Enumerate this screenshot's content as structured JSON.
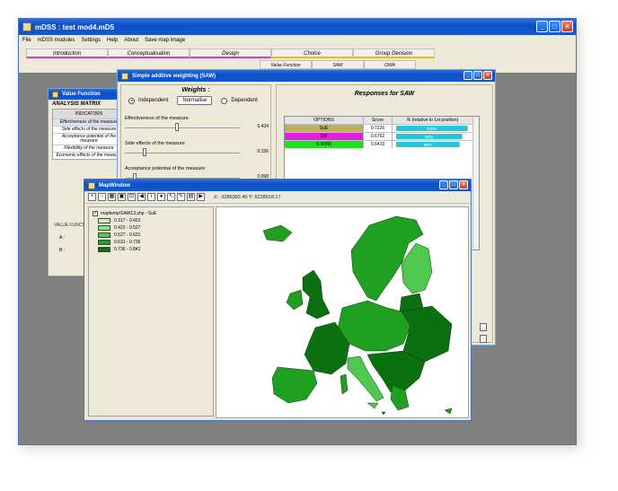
{
  "app": {
    "title": "mDSS : test mod4.mD5",
    "menu": [
      "File",
      "mDSS modules",
      "Settings",
      "Help",
      "About",
      "Save map image"
    ]
  },
  "phase_tabs": [
    {
      "label": "Introduction"
    },
    {
      "label": "Conceptualisation"
    },
    {
      "label": "Design"
    },
    {
      "label": "Choice"
    },
    {
      "label": "Group Decision"
    }
  ],
  "choice_subtabs": [
    {
      "label": "Value Function"
    },
    {
      "label": "SAW"
    },
    {
      "label": "OWA"
    }
  ],
  "value_function_window": {
    "title": "Value Function",
    "analysis_matrix": "ANALYSIS MATRIX",
    "indicators_header": "INDICATORS",
    "indicators": [
      "Effectiveness of the measure",
      "Side effects of the measure",
      "Acceptance potential of the measure",
      "Flexibility of the measure",
      "Economic effects of the measure"
    ],
    "value_function_label": "VALUE FUNCTION",
    "a_label": "A :",
    "b_label": "B :"
  },
  "saw_window": {
    "title": "Simple additive weighting (SAW)",
    "weights_title": "Weights :",
    "mode_independent": "Independent",
    "normalise_button": "Normalise",
    "mode_dependent": "Dependent",
    "criteria": [
      {
        "label": "Effectiveness of the measure",
        "value": 0.434,
        "value_text": "0.434"
      },
      {
        "label": "Side effects of the measure",
        "value": 0.156,
        "value_text": "0.156"
      },
      {
        "label": "Acceptance potential of the measure",
        "value": 0.068,
        "value_text": "0.068"
      }
    ],
    "responses_title": "Responses for SAW",
    "columns": [
      "OPTIONS",
      "Score",
      "% (relative to 1st position)"
    ],
    "rows": [
      {
        "option": "SuE",
        "score": "0.7226",
        "percent": "100%",
        "fraction": 1.0,
        "option_color": "#b8b060",
        "bar_color": "#20c8d8"
      },
      {
        "option": "SW",
        "score": "0.6762",
        "percent": "93%",
        "fraction": 0.93,
        "option_color": "#e020e0",
        "bar_color": "#20c8d8"
      },
      {
        "option": "S-W(M)",
        "score": "0.6419",
        "percent": "89%",
        "fraction": 0.89,
        "option_color": "#20e020",
        "bar_color": "#20c8d8"
      }
    ]
  },
  "map_window": {
    "title": "MapWindow",
    "coordinates": "X: -3286382.40  Y: 6228918.17",
    "layer_name": "maptemp\\SAW13.shp - SuE",
    "legend": [
      {
        "range": "0.317 - 0.422",
        "color": "#c8f0c0"
      },
      {
        "range": "0.422 - 0.527",
        "color": "#90e088"
      },
      {
        "range": "0.527 - 0.631",
        "color": "#50c850"
      },
      {
        "range": "0.631 - 0.736",
        "color": "#20a020"
      },
      {
        "range": "0.736 - 0.841",
        "color": "#0a7010"
      }
    ]
  }
}
